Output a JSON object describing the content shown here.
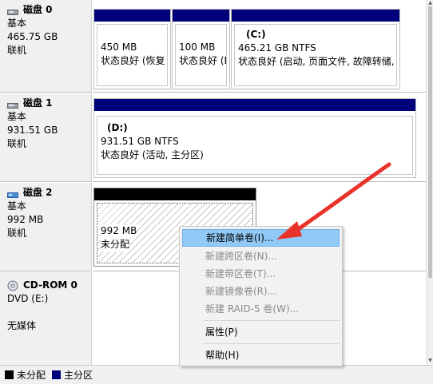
{
  "disks": [
    {
      "title": "磁盘 0",
      "type": "基本",
      "size": "465.75 GB",
      "status": "联机",
      "partitions": [
        {
          "name": "",
          "size": "450 MB",
          "status": "状态良好 (恢复"
        },
        {
          "name": "",
          "size": "100 MB",
          "status": "状态良好 (E"
        },
        {
          "name": "(C:)",
          "size": "465.21 GB NTFS",
          "status": "状态良好 (启动, 页面文件, 故障转储,"
        }
      ]
    },
    {
      "title": "磁盘 1",
      "type": "基本",
      "size": "931.51 GB",
      "status": "联机",
      "partitions": [
        {
          "name": "(D:)",
          "size": "931.51 GB NTFS",
          "status": "状态良好 (活动, 主分区)"
        }
      ]
    },
    {
      "title": "磁盘 2",
      "type": "基本",
      "size": "992 MB",
      "status": "联机",
      "partitions": [
        {
          "name": "",
          "size": "992 MB",
          "status": "未分配"
        }
      ]
    },
    {
      "title": "CD-ROM 0",
      "type": "DVD (E:)",
      "size": "",
      "status": "无媒体",
      "partitions": []
    }
  ],
  "context_menu": {
    "items": [
      {
        "label": "新建简单卷(I)...",
        "enabled": true,
        "selected": true
      },
      {
        "label": "新建跨区卷(N)...",
        "enabled": false
      },
      {
        "label": "新建带区卷(T)...",
        "enabled": false
      },
      {
        "label": "新建镜像卷(R)...",
        "enabled": false
      },
      {
        "label": "新建 RAID-5 卷(W)...",
        "enabled": false
      },
      {
        "label": "属性(P)",
        "enabled": true
      },
      {
        "label": "帮助(H)",
        "enabled": true
      }
    ]
  },
  "legend": {
    "unallocated": "未分配",
    "primary": "主分区",
    "unallocated_color": "#000000",
    "primary_color": "#00007a"
  },
  "colors": {
    "partition_bar": "#00007a",
    "menu_highlight": "#91c9f7",
    "annotation_arrow": "#e8332b"
  }
}
